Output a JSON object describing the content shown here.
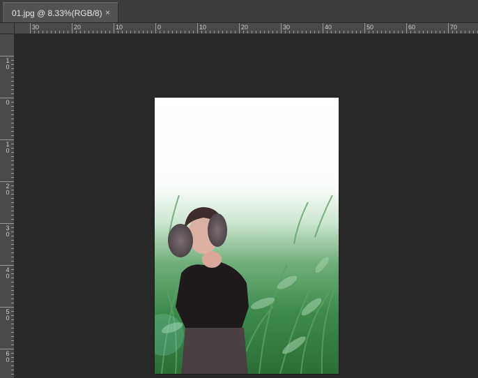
{
  "document": {
    "tab_title": "01.jpg @ 8.33%(RGB/8)",
    "close_glyph": "×",
    "zoom": "8.33%",
    "mode": "RGB/8"
  },
  "rulers": {
    "horizontal": [
      "30",
      "20",
      "10",
      "0",
      "10",
      "20",
      "30",
      "40",
      "50",
      "60",
      "70"
    ],
    "vertical": [
      [
        "1",
        "0"
      ],
      [
        "0"
      ],
      [
        "1",
        "0"
      ],
      [
        "2",
        "0"
      ],
      [
        "3",
        "0"
      ],
      [
        "4",
        "0"
      ],
      [
        "5",
        "0"
      ],
      [
        "6",
        "0"
      ]
    ]
  },
  "colors": {
    "workspace": "#282828",
    "tab_active": "#535353",
    "ruler": "#4a4a4a"
  }
}
